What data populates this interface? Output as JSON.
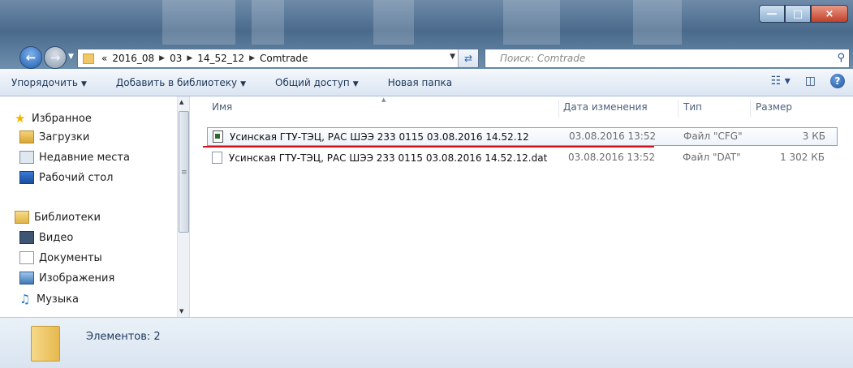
{
  "window": {
    "caption_buttons": [
      "—",
      "□",
      "×"
    ]
  },
  "navigation": {
    "back_icon": "back-arrow-icon",
    "forward_icon": "forward-arrow-icon",
    "breadcrumb_prefix": "«",
    "breadcrumbs": [
      "2016_08",
      "03",
      "14_52_12",
      "Comtrade"
    ],
    "search_placeholder": "Поиск: Comtrade"
  },
  "toolbar": {
    "organize": "Упорядочить",
    "add_to_library": "Добавить в библиотеку",
    "share": "Общий доступ",
    "new_folder": "Новая папка"
  },
  "sidebar": {
    "favorites_label": "Избранное",
    "favorites": [
      "Загрузки",
      "Недавние места",
      "Рабочий стол"
    ],
    "libraries_label": "Библиотеки",
    "libraries": [
      "Видео",
      "Документы",
      "Изображения",
      "Музыка"
    ]
  },
  "columns": {
    "name": "Имя",
    "date_modified": "Дата изменения",
    "type": "Тип",
    "size": "Размер"
  },
  "files": [
    {
      "name": "Усинская ГТУ-ТЭЦ, РАС ШЭЭ 233 0115 03.08.2016 14.52.12",
      "date": "03.08.2016 13:52",
      "type": "Файл \"CFG\"",
      "size": "3 КБ",
      "selected": true,
      "icon": "cfg-file-icon"
    },
    {
      "name": "Усинская ГТУ-ТЭЦ, РАС ШЭЭ 233 0115 03.08.2016 14.52.12.dat",
      "date": "03.08.2016 13:52",
      "type": "Файл \"DAT\"",
      "size": "1 302 КБ",
      "selected": false,
      "icon": "dat-file-icon"
    }
  ],
  "status": {
    "item_count": "Элементов: 2"
  },
  "colors": {
    "highlight_underline": "#d1141b",
    "selection_border": "#7da2ce"
  }
}
